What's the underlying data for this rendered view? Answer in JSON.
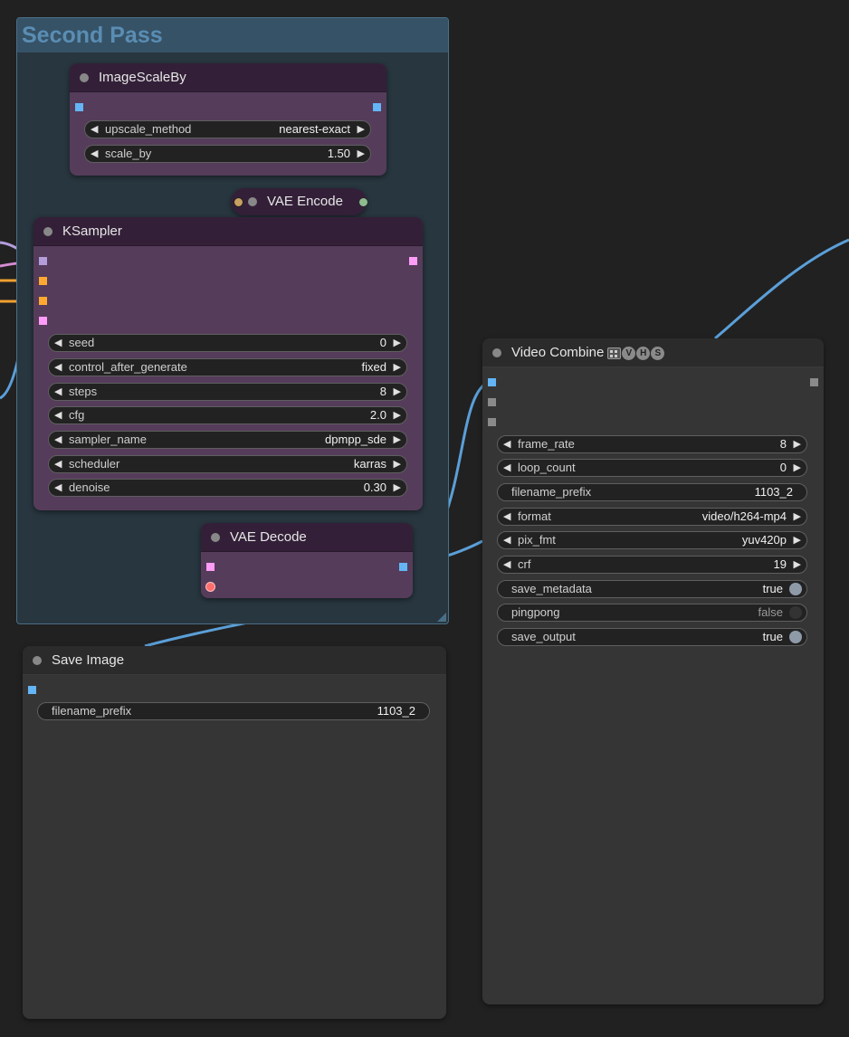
{
  "colors": {
    "image_slot": "#64b5f6",
    "latent_slot": "#ff9cf9",
    "model_slot": "#b39ddb",
    "conditioning_slot": "#ffa931",
    "vae_slot": "#ff6e6e",
    "image_wire": "#5b9fd8",
    "latent_wire": "#d58cd2",
    "conditioning_wire": "#f0a030",
    "gray_slot": "#8a8a8a"
  },
  "group": {
    "title": "Second Pass"
  },
  "nodes": {
    "image_scale_by": {
      "title": "ImageScaleBy",
      "widgets": [
        {
          "label": "upscale_method",
          "value": "nearest-exact"
        },
        {
          "label": "scale_by",
          "value": "1.50"
        }
      ]
    },
    "vae_encode": {
      "title": "VAE Encode"
    },
    "ksampler": {
      "title": "KSampler",
      "widgets": [
        {
          "label": "seed",
          "value": "0"
        },
        {
          "label": "control_after_generate",
          "value": "fixed"
        },
        {
          "label": "steps",
          "value": "8"
        },
        {
          "label": "cfg",
          "value": "2.0"
        },
        {
          "label": "sampler_name",
          "value": "dpmpp_sde"
        },
        {
          "label": "scheduler",
          "value": "karras"
        },
        {
          "label": "denoise",
          "value": "0.30"
        }
      ]
    },
    "vae_decode": {
      "title": "VAE Decode"
    },
    "save_image": {
      "title": "Save Image",
      "widgets": [
        {
          "label": "filename_prefix",
          "value": "1103_2"
        }
      ]
    },
    "video_combine": {
      "title": "Video Combine",
      "badge_letters": [
        "V",
        "H",
        "S"
      ],
      "icon": "film-icon",
      "widgets": [
        {
          "label": "frame_rate",
          "value": "8"
        },
        {
          "label": "loop_count",
          "value": "0"
        },
        {
          "label": "filename_prefix",
          "value": "1103_2"
        },
        {
          "label": "format",
          "value": "video/h264-mp4"
        },
        {
          "label": "pix_fmt",
          "value": "yuv420p"
        },
        {
          "label": "crf",
          "value": "19"
        },
        {
          "label": "save_metadata",
          "value": "true"
        },
        {
          "label": "pingpong",
          "value": "false"
        },
        {
          "label": "save_output",
          "value": "true"
        }
      ]
    }
  },
  "icons": {
    "arrow_left": "◀",
    "arrow_right": "▶"
  }
}
